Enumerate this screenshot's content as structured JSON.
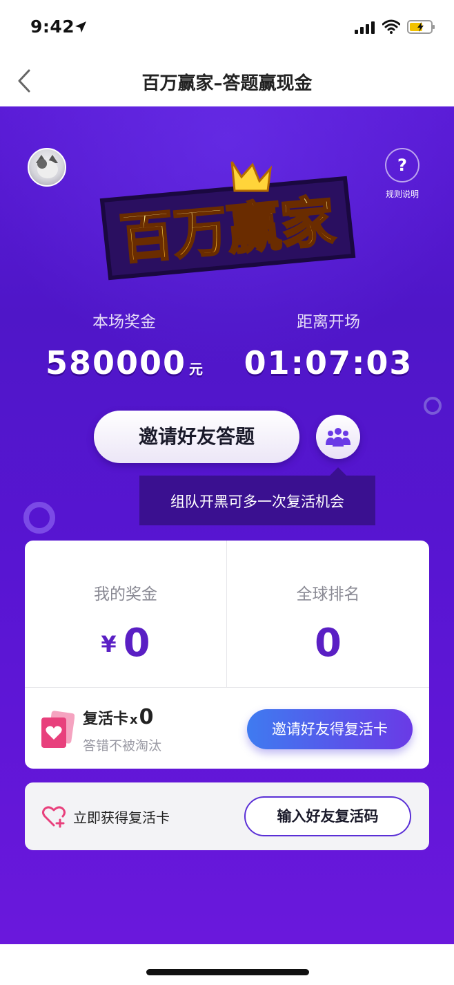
{
  "status_bar": {
    "time": "9:42"
  },
  "nav": {
    "title": "百万赢家–答题赢现金"
  },
  "header": {
    "rules_label": "规则说明",
    "rules_glyph": "?",
    "logo_text": "百万赢家"
  },
  "stats": {
    "prize_label": "本场奖金",
    "prize_value": "580000",
    "prize_unit": "元",
    "countdown_label": "距离开场",
    "countdown_value": "01:07:03"
  },
  "invite": {
    "button_label": "邀请好友答题",
    "tooltip": "组队开黑可多一次复活机会"
  },
  "prize_card": {
    "my_prize_label": "我的奖金",
    "currency_symbol": "¥",
    "my_prize_value": "0",
    "rank_label": "全球排名",
    "rank_value": "0",
    "revive_title": "复活卡",
    "revive_x": "x",
    "revive_count": "0",
    "revive_subtitle": "答错不被淘汰",
    "revive_button": "邀请好友得复活卡"
  },
  "code_card": {
    "label": "立即获得复活卡",
    "button": "输入好友复活码"
  },
  "colors": {
    "hero_purple": "#5a1bd6",
    "accent_purple": "#5a1fc4",
    "button_blue": "#3f7bf0",
    "revive_pink": "#e8407c"
  },
  "icons": [
    "location-arrow-icon",
    "signal-icon",
    "wifi-icon",
    "battery-icon",
    "back-chevron-icon",
    "question-icon",
    "team-icon",
    "revive-card-icon",
    "heart-plus-icon"
  ]
}
